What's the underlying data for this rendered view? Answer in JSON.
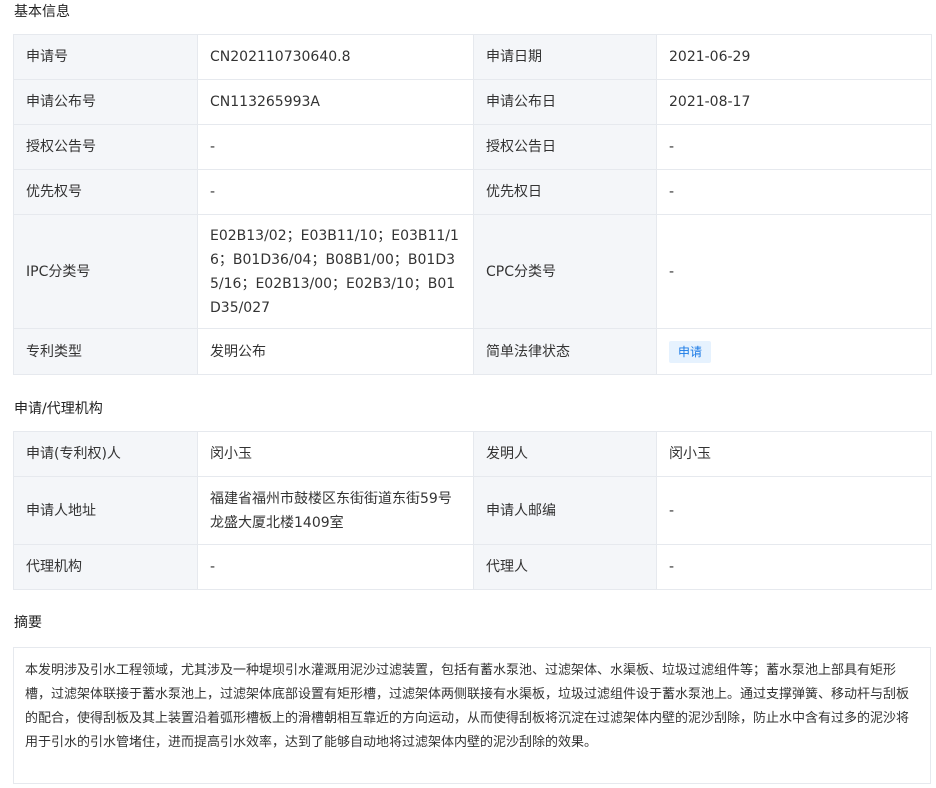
{
  "sections": {
    "basic": "基本信息",
    "agency": "申请/代理机构",
    "abstract": "摘要"
  },
  "basic": {
    "app_no_label": "申请号",
    "app_no": "CN202110730640.8",
    "app_date_label": "申请日期",
    "app_date": "2021-06-29",
    "pub_no_label": "申请公布号",
    "pub_no": "CN113265993A",
    "pub_date_label": "申请公布日",
    "pub_date": "2021-08-17",
    "grant_no_label": "授权公告号",
    "grant_no": "-",
    "grant_date_label": "授权公告日",
    "grant_date": "-",
    "priority_no_label": "优先权号",
    "priority_no": "-",
    "priority_date_label": "优先权日",
    "priority_date": "-",
    "ipc_label": "IPC分类号",
    "ipc": "E02B13/02；E03B11/10；E03B11/16；B01D36/04；B08B1/00；B01D35/16；E02B13/00；E02B3/10；B01D35/027",
    "cpc_label": "CPC分类号",
    "cpc": "-",
    "type_label": "专利类型",
    "type": "发明公布",
    "legal_label": "简单法律状态",
    "legal_status": "申请"
  },
  "agency": {
    "applicant_label": "申请(专利权)人",
    "applicant": "闵小玉",
    "inventor_label": "发明人",
    "inventor": "闵小玉",
    "address_label": "申请人地址",
    "address": "福建省福州市鼓楼区东街街道东街59号龙盛大厦北楼1409室",
    "postcode_label": "申请人邮编",
    "postcode": "-",
    "agent_org_label": "代理机构",
    "agent_org": "-",
    "agent_label": "代理人",
    "agent": "-"
  },
  "abstract_text": "本发明涉及引水工程领域，尤其涉及一种堤坝引水灌溉用泥沙过滤装置，包括有蓄水泵池、过滤架体、水渠板、垃圾过滤组件等；蓄水泵池上部具有矩形槽，过滤架体联接于蓄水泵池上，过滤架体底部设置有矩形槽，过滤架体两侧联接有水渠板，垃圾过滤组件设于蓄水泵池上。通过支撑弹簧、移动杆与刮板的配合，使得刮板及其上装置沿着弧形槽板上的滑槽朝相互靠近的方向运动，从而使得刮板将沉淀在过滤架体内壁的泥沙刮除，防止水中含有过多的泥沙将用于引水的引水管堵住，进而提高引水效率，达到了能够自动地将过滤架体内壁的泥沙刮除的效果。"
}
